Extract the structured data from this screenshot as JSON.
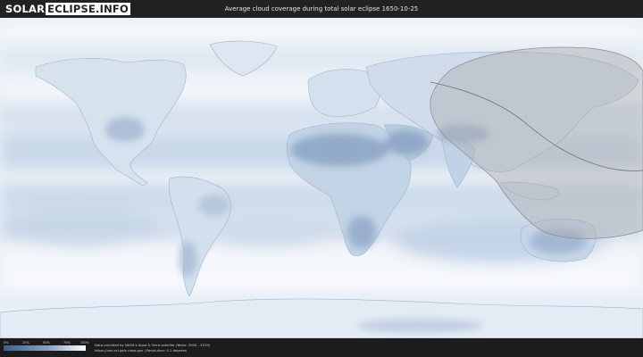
{
  "header": {
    "logo_left": "SOLAR",
    "logo_right": "ECLIPSE.INFO",
    "title": "Average cloud coverage during total solar eclipse 1650-10-25"
  },
  "legend": {
    "scale_labels": [
      "0%",
      "25%",
      "50%",
      "75%",
      "100%"
    ],
    "scale_colors": [
      "#3f5f8c",
      "#ffffff"
    ]
  },
  "footer": {
    "credit_line1": "Data provided by NASA's Aqua & Terra satellite (Years: 2000 - 2019)",
    "credit_line2": "https://neo.sci.gsfc.nasa.gov  |  Resolution: 0.1 degrees"
  },
  "colors": {
    "cloud_free": "#3f5f8c",
    "overcast": "#ffffff",
    "eclipse_zone": "#b4b4b4",
    "header_bg": "#222222"
  }
}
